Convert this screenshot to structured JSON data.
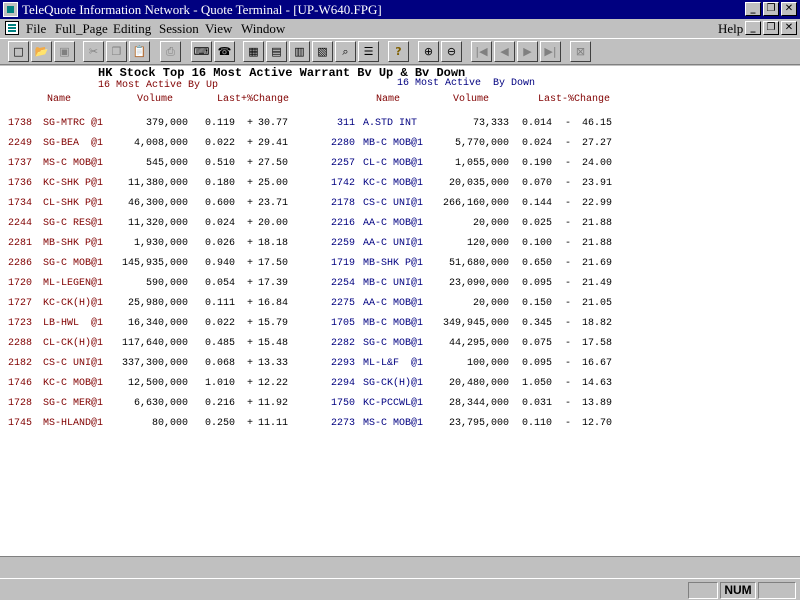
{
  "window": {
    "title": "TeleQuote Information Network - Quote Terminal - [UP-W640.FPG]",
    "controls": {
      "minimize": "_",
      "restore": "❐",
      "close": "✕"
    }
  },
  "menu": {
    "items": [
      "File",
      "Full_Page",
      "Editing",
      "Session",
      "View",
      "Window"
    ],
    "help": "Help"
  },
  "toolbar": {
    "buttons": [
      {
        "icon": "new-file-icon",
        "glyph": "□"
      },
      {
        "icon": "open-folder-icon",
        "glyph": "📂"
      },
      {
        "icon": "save-icon",
        "glyph": "▣"
      },
      {
        "icon": "cut-icon",
        "glyph": "✂"
      },
      {
        "icon": "copy-icon",
        "glyph": "❐"
      },
      {
        "icon": "paste-icon",
        "glyph": "📋"
      },
      {
        "icon": "print-icon",
        "glyph": "⎙"
      },
      {
        "icon": "keyboard-icon",
        "glyph": "⌨"
      },
      {
        "icon": "phone-icon",
        "glyph": "☎"
      },
      {
        "icon": "grid-icon",
        "glyph": "▦"
      },
      {
        "icon": "calc-icon",
        "glyph": "▤"
      },
      {
        "icon": "chart-icon",
        "glyph": "▥"
      },
      {
        "icon": "bar-chart-icon",
        "glyph": "▧"
      },
      {
        "icon": "magnifier-icon",
        "glyph": "⌕"
      },
      {
        "icon": "list-icon",
        "glyph": "☰"
      },
      {
        "icon": "help-icon",
        "glyph": "?"
      },
      {
        "icon": "zoom-in-icon",
        "glyph": "⊕"
      },
      {
        "icon": "zoom-out-icon",
        "glyph": "⊖"
      },
      {
        "icon": "first-page-icon",
        "glyph": "|◀"
      },
      {
        "icon": "prev-page-icon",
        "glyph": "◀"
      },
      {
        "icon": "next-page-icon",
        "glyph": "▶"
      },
      {
        "icon": "last-page-icon",
        "glyph": "▶|"
      },
      {
        "icon": "stop-icon",
        "glyph": "⊠"
      }
    ]
  },
  "report": {
    "title": "HK Stock Top 16 Most Active Warrant Bv Up & Bv Down",
    "up_subtitle": "16 Most Active By Up",
    "down_subtitle": "16 Most Active  By Down",
    "up_headers": {
      "name": "Name",
      "volume": "Volume",
      "last_change": "Last+%Change"
    },
    "down_headers": {
      "name": "Name",
      "volume": "Volume",
      "last_change": "Last-%Change"
    },
    "up_rows": [
      {
        "code": "1738",
        "name": "SG-MTRC @1",
        "volume": "379,000",
        "last": "0.119",
        "sign": "+",
        "change": "30.77"
      },
      {
        "code": "2249",
        "name": "SG-BEA  @1",
        "volume": "4,008,000",
        "last": "0.022",
        "sign": "+",
        "change": "29.41"
      },
      {
        "code": "1737",
        "name": "MS-C MOB@1",
        "volume": "545,000",
        "last": "0.510",
        "sign": "+",
        "change": "27.50"
      },
      {
        "code": "1736",
        "name": "KC-SHK P@1",
        "volume": "11,380,000",
        "last": "0.180",
        "sign": "+",
        "change": "25.00"
      },
      {
        "code": "1734",
        "name": "CL-SHK P@1",
        "volume": "46,300,000",
        "last": "0.600",
        "sign": "+",
        "change": "23.71"
      },
      {
        "code": "2244",
        "name": "SG-C RES@1",
        "volume": "11,320,000",
        "last": "0.024",
        "sign": "+",
        "change": "20.00"
      },
      {
        "code": "2281",
        "name": "MB-SHK P@1",
        "volume": "1,930,000",
        "last": "0.026",
        "sign": "+",
        "change": "18.18"
      },
      {
        "code": "2286",
        "name": "SG-C MOB@1",
        "volume": "145,935,000",
        "last": "0.940",
        "sign": "+",
        "change": "17.50"
      },
      {
        "code": "1720",
        "name": "ML-LEGEN@1",
        "volume": "590,000",
        "last": "0.054",
        "sign": "+",
        "change": "17.39"
      },
      {
        "code": "1727",
        "name": "KC-CK(H)@1",
        "volume": "25,980,000",
        "last": "0.111",
        "sign": "+",
        "change": "16.84"
      },
      {
        "code": "1723",
        "name": "LB-HWL  @1",
        "volume": "16,340,000",
        "last": "0.022",
        "sign": "+",
        "change": "15.79"
      },
      {
        "code": "2288",
        "name": "CL-CK(H)@1",
        "volume": "117,640,000",
        "last": "0.485",
        "sign": "+",
        "change": "15.48"
      },
      {
        "code": "2182",
        "name": "CS-C UNI@1",
        "volume": "337,300,000",
        "last": "0.068",
        "sign": "+",
        "change": "13.33"
      },
      {
        "code": "1746",
        "name": "KC-C MOB@1",
        "volume": "12,500,000",
        "last": "1.010",
        "sign": "+",
        "change": "12.22"
      },
      {
        "code": "1728",
        "name": "SG-C MER@1",
        "volume": "6,630,000",
        "last": "0.216",
        "sign": "+",
        "change": "11.92"
      },
      {
        "code": "1745",
        "name": "MS-HLAND@1",
        "volume": "80,000",
        "last": "0.250",
        "sign": "+",
        "change": "11.11"
      }
    ],
    "down_rows": [
      {
        "code": "311",
        "name": "A.STD INT",
        "volume": "73,333",
        "last": "0.014",
        "sign": "-",
        "change": "46.15"
      },
      {
        "code": "2280",
        "name": "MB-C MOB@1",
        "volume": "5,770,000",
        "last": "0.024",
        "sign": "-",
        "change": "27.27"
      },
      {
        "code": "2257",
        "name": "CL-C MOB@1",
        "volume": "1,055,000",
        "last": "0.190",
        "sign": "-",
        "change": "24.00"
      },
      {
        "code": "1742",
        "name": "KC-C MOB@1",
        "volume": "20,035,000",
        "last": "0.070",
        "sign": "-",
        "change": "23.91"
      },
      {
        "code": "2178",
        "name": "CS-C UNI@1",
        "volume": "266,160,000",
        "last": "0.144",
        "sign": "-",
        "change": "22.99"
      },
      {
        "code": "2216",
        "name": "AA-C MOB@1",
        "volume": "20,000",
        "last": "0.025",
        "sign": "-",
        "change": "21.88"
      },
      {
        "code": "2259",
        "name": "AA-C UNI@1",
        "volume": "120,000",
        "last": "0.100",
        "sign": "-",
        "change": "21.88"
      },
      {
        "code": "1719",
        "name": "MB-SHK P@1",
        "volume": "51,680,000",
        "last": "0.650",
        "sign": "-",
        "change": "21.69"
      },
      {
        "code": "2254",
        "name": "MB-C UNI@1",
        "volume": "23,090,000",
        "last": "0.095",
        "sign": "-",
        "change": "21.49"
      },
      {
        "code": "2275",
        "name": "AA-C MOB@1",
        "volume": "20,000",
        "last": "0.150",
        "sign": "-",
        "change": "21.05"
      },
      {
        "code": "1705",
        "name": "MB-C MOB@1",
        "volume": "349,945,000",
        "last": "0.345",
        "sign": "-",
        "change": "18.82"
      },
      {
        "code": "2282",
        "name": "SG-C MOB@1",
        "volume": "44,295,000",
        "last": "0.075",
        "sign": "-",
        "change": "17.58"
      },
      {
        "code": "2293",
        "name": "ML-L&F  @1",
        "volume": "100,000",
        "last": "0.095",
        "sign": "-",
        "change": "16.67"
      },
      {
        "code": "2294",
        "name": "SG-CK(H)@1",
        "volume": "20,480,000",
        "last": "1.050",
        "sign": "-",
        "change": "14.63"
      },
      {
        "code": "1750",
        "name": "KC-PCCWL@1",
        "volume": "28,344,000",
        "last": "0.031",
        "sign": "-",
        "change": "13.89"
      },
      {
        "code": "2273",
        "name": "MS-C MOB@1",
        "volume": "23,795,000",
        "last": "0.110",
        "sign": "-",
        "change": "12.70"
      }
    ]
  },
  "status": {
    "num_lock": "NUM"
  }
}
